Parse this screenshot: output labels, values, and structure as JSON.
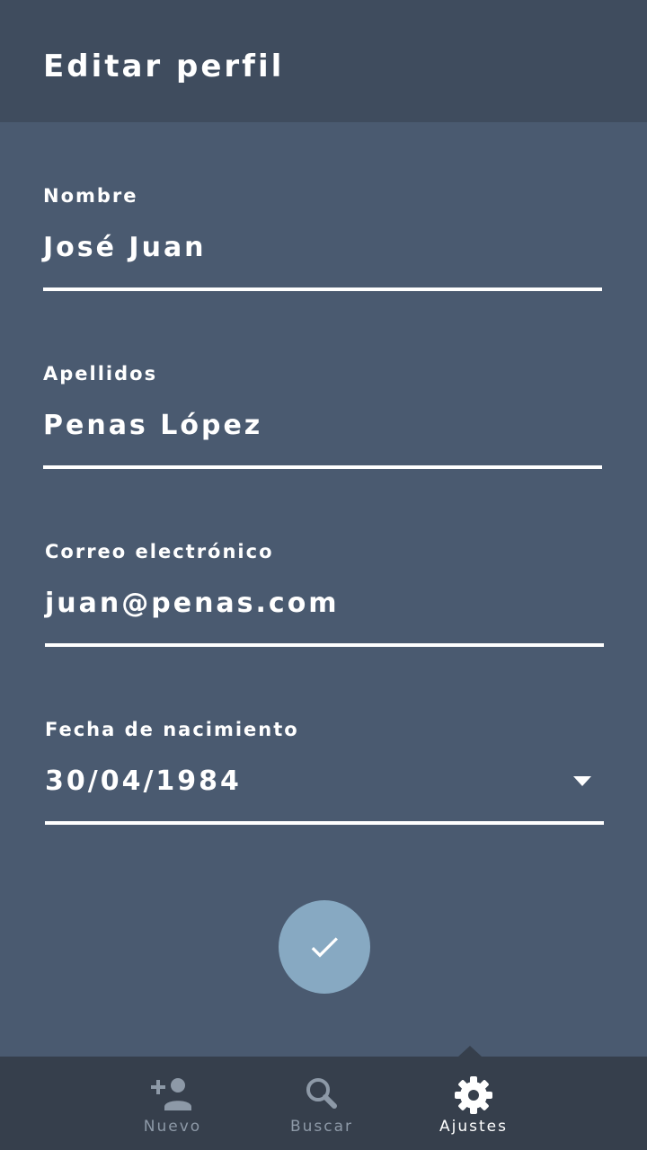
{
  "header": {
    "title": "Editar perfil"
  },
  "form": {
    "fields": [
      {
        "label": "Nombre",
        "value": "José Juan"
      },
      {
        "label": "Apellidos",
        "value": "Penas López"
      },
      {
        "label": "Correo electrónico",
        "value": "juan@penas.com"
      },
      {
        "label": "Fecha de nacimiento",
        "value": "30/04/1984"
      }
    ]
  },
  "confirm": {
    "icon": "check-icon"
  },
  "bottom_nav": {
    "items": [
      {
        "label": "Nuevo",
        "icon": "add-person-icon",
        "active": false
      },
      {
        "label": "Buscar",
        "icon": "search-icon",
        "active": false
      },
      {
        "label": "Ajustes",
        "icon": "gear-icon",
        "active": true
      }
    ]
  },
  "colors": {
    "background": "#4a5a70",
    "header": "#3f4c5e",
    "bottom_nav": "#363f4c",
    "accent": "#87a9c2",
    "text": "#ffffff",
    "inactive": "#8d99a7"
  }
}
